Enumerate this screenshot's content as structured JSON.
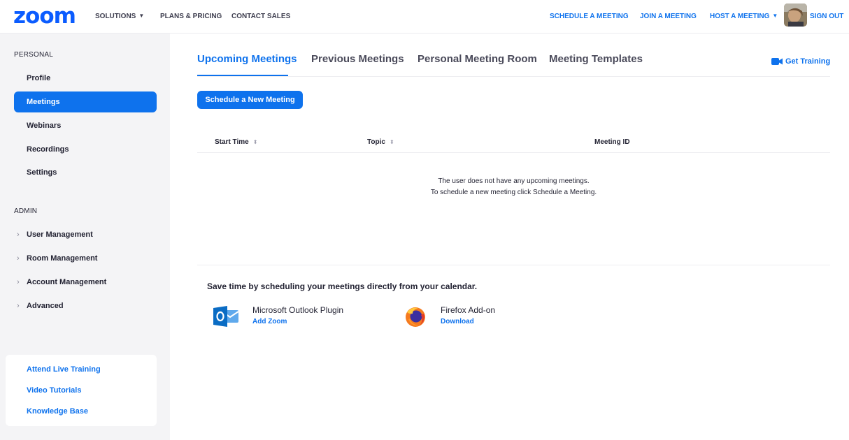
{
  "brand": {
    "logo": "zoom",
    "accent": "#0e72ed"
  },
  "topnav": {
    "left": [
      {
        "label": "SOLUTIONS",
        "has_caret": true
      },
      {
        "label": "PLANS & PRICING"
      },
      {
        "label": "CONTACT SALES"
      }
    ],
    "right": [
      {
        "label": "SCHEDULE A MEETING"
      },
      {
        "label": "JOIN A MEETING"
      },
      {
        "label": "HOST A MEETING",
        "has_caret": true
      },
      {
        "label": "SIGN OUT"
      }
    ]
  },
  "sidebar": {
    "personal_header": "PERSONAL",
    "personal_items": [
      {
        "label": "Profile"
      },
      {
        "label": "Meetings",
        "active": true
      },
      {
        "label": "Webinars"
      },
      {
        "label": "Recordings"
      },
      {
        "label": "Settings"
      }
    ],
    "admin_header": "ADMIN",
    "admin_items": [
      {
        "label": "User Management"
      },
      {
        "label": "Room Management"
      },
      {
        "label": "Account Management"
      },
      {
        "label": "Advanced"
      }
    ],
    "help_links": [
      {
        "label": "Attend Live Training"
      },
      {
        "label": "Video Tutorials"
      },
      {
        "label": "Knowledge Base"
      }
    ]
  },
  "main": {
    "tabs": [
      {
        "label": "Upcoming Meetings",
        "active": true
      },
      {
        "label": "Previous Meetings"
      },
      {
        "label": "Personal Meeting Room"
      },
      {
        "label": "Meeting Templates"
      }
    ],
    "get_training": "Get Training",
    "schedule_button": "Schedule a New Meeting",
    "table": {
      "columns": [
        {
          "label": "Start Time",
          "sortable": true
        },
        {
          "label": "Topic",
          "sortable": true
        },
        {
          "label": "Meeting ID",
          "sortable": false
        }
      ],
      "empty_line1": "The user does not have any upcoming meetings.",
      "empty_line2": "To schedule a new meeting click Schedule a Meeting."
    },
    "calendar": {
      "title": "Save time by scheduling your meetings directly from your calendar.",
      "plugins": [
        {
          "name": "Microsoft Outlook Plugin",
          "link": "Add Zoom",
          "icon": "outlook-icon"
        },
        {
          "name": "Firefox Add-on",
          "link": "Download",
          "icon": "firefox-icon"
        }
      ]
    }
  }
}
